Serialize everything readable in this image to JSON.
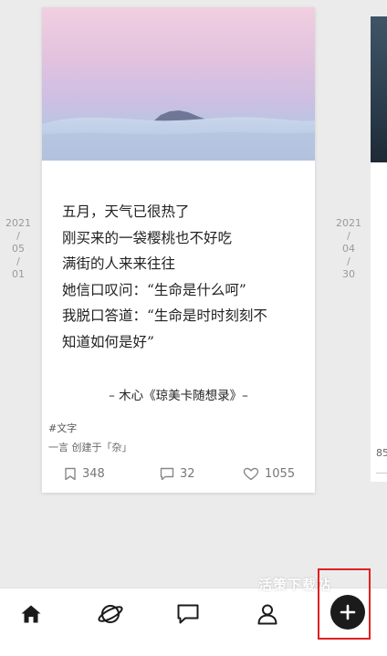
{
  "dates": {
    "left": {
      "year": "2021",
      "month": "05",
      "day": "01",
      "sep": "/"
    },
    "right": {
      "year": "2021",
      "month": "04",
      "day": "30",
      "sep": "/"
    }
  },
  "card": {
    "quote_lines": [
      "五月，天气已很热了",
      "刚买来的一袋樱桃也不好吃",
      "满街的人来来往往",
      "她信口叹问：“生命是什么呵”",
      "我脱口答道：“生命是时时刻刻不",
      "知道如何是好”"
    ],
    "citation": "– 木心《琼美卡随想录》–",
    "tag": "#文字",
    "meta": "一言 创建于「杂」",
    "stats": {
      "bookmarks": "348",
      "comments": "32",
      "likes": "1055"
    }
  },
  "side_card": {
    "count_partial": "85"
  },
  "tabbar": {
    "items": [
      "home-icon",
      "planet-icon",
      "message-icon",
      "profile-icon",
      "add-icon"
    ]
  },
  "watermark": "活策下载站",
  "colors": {
    "highlight": "#e02020",
    "add_button": "#1b1b1b",
    "date_text": "#9a9a9a"
  }
}
